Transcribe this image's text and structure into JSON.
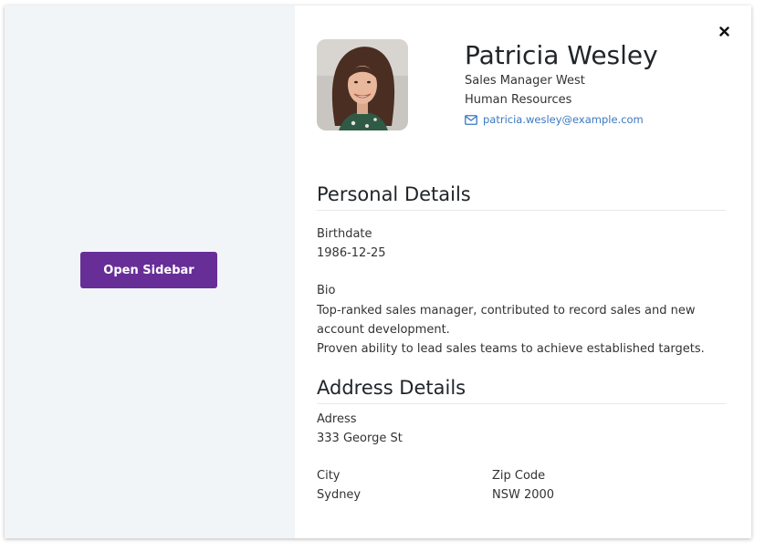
{
  "left_panel": {
    "open_button_label": "Open Sidebar"
  },
  "profile": {
    "name": "Patricia Wesley",
    "role": "Sales Manager West",
    "department": "Human Resources",
    "email": "patricia.wesley@example.com"
  },
  "personal": {
    "title": "Personal Details",
    "birthdate_label": "Birthdate",
    "birthdate_value": "1986-12-25",
    "bio_label": "Bio",
    "bio_line1": "Top-ranked sales manager, contributed to record sales and new account development.",
    "bio_line2": "Proven ability to lead sales teams to achieve established targets."
  },
  "address": {
    "title": "Address Details",
    "address_label": "Adress",
    "address_value": "333 George St",
    "city_label": "City",
    "city_value": "Sydney",
    "zip_label": "Zip Code",
    "zip_value": "NSW 2000"
  },
  "icons": {
    "close": "close-icon",
    "email": "envelope-icon"
  },
  "colors": {
    "accent": "#682e98",
    "link": "#3a78c2",
    "left_bg": "#f1f5f8"
  }
}
